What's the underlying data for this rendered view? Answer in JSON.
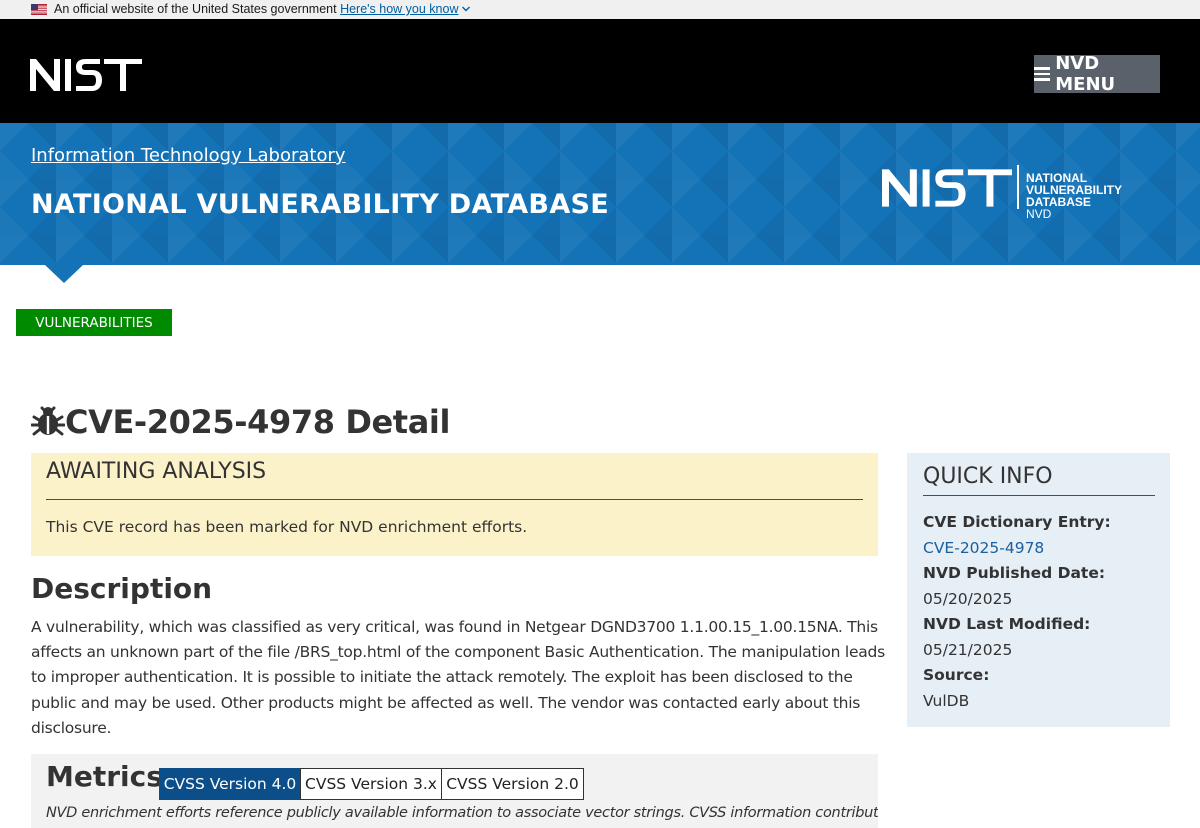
{
  "gov_banner": {
    "text": "An official website of the United States government",
    "link": "Here's how you know"
  },
  "header": {
    "menu_label": "NVD MENU",
    "logo_icon": "nist-logo"
  },
  "banner": {
    "itl_link": "Information Technology Laboratory",
    "title": "NATIONAL VULNERABILITY DATABASE",
    "logo_lines": [
      "NATIONAL VULNERABILITY",
      "DATABASE",
      "NVD"
    ]
  },
  "breadcrumb": {
    "label": "VULNERABILITIES"
  },
  "page": {
    "title": "CVE-2025-4978 Detail",
    "title_icon": "bug-icon"
  },
  "awaiting": {
    "title": "AWAITING ANALYSIS",
    "text": "This CVE record has been marked for NVD enrichment efforts."
  },
  "description": {
    "heading": "Description",
    "text": "A vulnerability, which was classified as very critical, was found in Netgear DGND3700 1.1.00.15_1.00.15NA. This affects an unknown part of the file /BRS_top.html of the component Basic Authentication. The manipulation leads to improper authentication. It is possible to initiate the attack remotely. The exploit has been disclosed to the public and may be used. Other products might be affected as well. The vendor was contacted early about this disclosure."
  },
  "quick_info": {
    "title": "QUICK INFO",
    "cve_entry_label": "CVE Dictionary Entry:",
    "cve_entry_value": "CVE-2025-4978",
    "published_label": "NVD Published Date:",
    "published_value": "05/20/2025",
    "modified_label": "NVD Last Modified:",
    "modified_value": "05/21/2025",
    "source_label": "Source:",
    "source_value": "VulDB"
  },
  "metrics": {
    "heading": "Metrics",
    "tabs": [
      {
        "label": "CVSS Version 4.0",
        "active": true
      },
      {
        "label": "CVSS Version 3.x",
        "active": false
      },
      {
        "label": "CVSS Version 2.0",
        "active": false
      }
    ],
    "note": "NVD enrichment efforts reference publicly available information to associate vector strings. CVSS information contributed by other"
  },
  "colors": {
    "banner_blue": "#1472b6",
    "breadcrumb_green": "#008a00",
    "awaiting_bg": "#fcf2c9",
    "quick_info_bg": "#e6eef6",
    "tab_active": "#0b4e8a",
    "link": "#1a5f9e"
  }
}
